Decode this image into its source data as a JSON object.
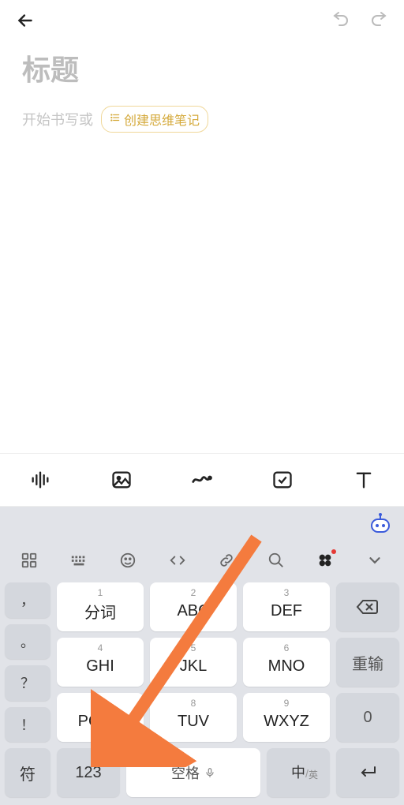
{
  "editor": {
    "title_placeholder": "标题",
    "body_placeholder": "开始书写或",
    "mindnote_pill": "创建思维笔记"
  },
  "toolbar": {
    "items": [
      "audio-wave-icon",
      "image-icon",
      "draw-icon",
      "checkbox-icon",
      "text-icon"
    ]
  },
  "keyboard": {
    "iconrow": [
      "grid-icon",
      "keyboard-layout-icon",
      "emoji-icon",
      "code-icon",
      "link-icon",
      "search-icon",
      "clover-icon",
      "chevron-down-icon"
    ],
    "punct": [
      "，",
      "。",
      "？",
      "！"
    ],
    "keys": [
      {
        "num": "1",
        "label": "分词"
      },
      {
        "num": "2",
        "label": "ABC"
      },
      {
        "num": "3",
        "label": "DEF"
      },
      {
        "num": "4",
        "label": "GHI"
      },
      {
        "num": "5",
        "label": "JKL"
      },
      {
        "num": "6",
        "label": "MNO"
      },
      {
        "num": "7",
        "label": "PQRS"
      },
      {
        "num": "8",
        "label": "TUV"
      },
      {
        "num": "9",
        "label": "WXYZ"
      }
    ],
    "zero": "0",
    "reinput": "重输",
    "sym": "符",
    "num": "123",
    "space": "空格",
    "lang_main": "中",
    "lang_sub": "英"
  },
  "annotation": {
    "arrow_target": "123-key"
  }
}
